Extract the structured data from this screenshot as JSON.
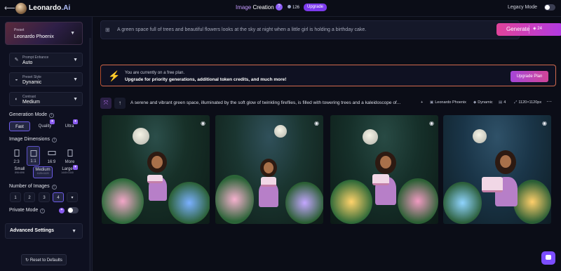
{
  "topbar": {
    "back_icon": "back-arrow-icon",
    "brand_main": "Leonardo",
    "brand_suffix": ".Ai",
    "title_accent": "Image",
    "title_rest": " Creation",
    "help_badge": "?",
    "tokens": "126",
    "upgrade": "Upgrade",
    "legacy_mode": "Legacy Mode",
    "legacy_on": false
  },
  "sidebar": {
    "preset_label": "Preset",
    "preset_value": "Leonardo Phoenix",
    "prompt_enhance_label": "Prompt Enhance",
    "prompt_enhance_value": "Auto",
    "preset_style_label": "Preset Style",
    "preset_style_value": "Dynamic",
    "contrast_label": "Contrast",
    "contrast_value": "Medium",
    "generation_mode": "Generation Mode",
    "modes": [
      "Fast",
      "Quality",
      "Ultra"
    ],
    "active_mode": "Fast",
    "image_dimensions": "Image Dimensions",
    "ratios": [
      "2:3",
      "1:1",
      "16:9",
      "More"
    ],
    "active_ratio": "1:1",
    "sizes": [
      {
        "label": "Small",
        "res": "896×896"
      },
      {
        "label": "Medium",
        "res": "1120×1120"
      },
      {
        "label": "Large",
        "res": "1440×1440"
      }
    ],
    "active_size": "Medium",
    "number_of_images": "Number of Images",
    "counts": [
      "1",
      "2",
      "3",
      "4"
    ],
    "active_count": "4",
    "private_mode": "Private Mode",
    "private_on": false,
    "advanced_settings": "Advanced Settings",
    "reset": "Reset to Defaults"
  },
  "main": {
    "prompt_text": "A green space full of trees and beautiful flowers looks at the sky at night when a little girl is holding a birthday cake.",
    "generate_label": "Generate",
    "generate_cost": "24",
    "banner_line1": "You are currently on a free plan.",
    "banner_line2": "Upgrade for priority generations, additional token credits, and much more!",
    "upgrade_plan": "Upgrade Plan",
    "generation_text": "A serene and vibrant green space, illuminated by the soft glow of twinkling fireflies, is filled with towering trees and a kaleidoscope of...",
    "meta_model": "Leonardo Phoenix",
    "meta_style": "Dynamic",
    "meta_count": "4",
    "meta_size": "1120×1120px",
    "more": "···"
  },
  "colors": {
    "accent": "#8b5cf6",
    "generate_start": "#e0439a",
    "generate_end": "#b23ae2",
    "banner_border": "#d36a4e"
  }
}
